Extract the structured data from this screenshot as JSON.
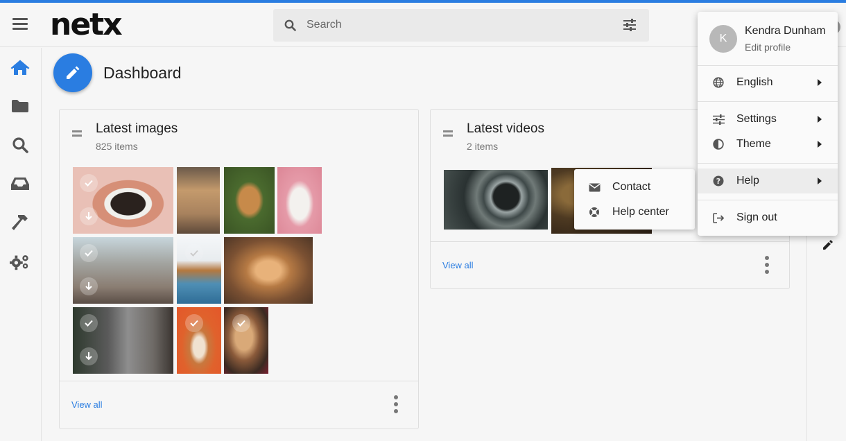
{
  "app": {
    "logo": "netx"
  },
  "search": {
    "placeholder": "Search"
  },
  "sidebar": {
    "items": [
      {
        "name": "home",
        "icon": "home-icon",
        "active": true
      },
      {
        "name": "folders",
        "icon": "folder-icon"
      },
      {
        "name": "search",
        "icon": "search-icon"
      },
      {
        "name": "inbox",
        "icon": "inbox-icon"
      },
      {
        "name": "tools",
        "icon": "hammer-icon"
      },
      {
        "name": "admin",
        "icon": "gears-icon"
      }
    ]
  },
  "page": {
    "title": "Dashboard"
  },
  "cards": {
    "images": {
      "title": "Latest images",
      "count": "825 items",
      "view_all": "View all"
    },
    "videos": {
      "title": "Latest videos",
      "count": "2 items",
      "view_all": "View all"
    }
  },
  "user_menu": {
    "avatar_initial": "K",
    "user_name": "Kendra Dunham",
    "edit_profile": "Edit profile",
    "items": [
      {
        "label": "English",
        "icon": "globe-icon",
        "has_submenu": true
      },
      {
        "label": "Settings",
        "icon": "sliders-icon",
        "has_submenu": true
      },
      {
        "label": "Theme",
        "icon": "contrast-icon",
        "has_submenu": true
      },
      {
        "label": "Help",
        "icon": "question-circle-icon",
        "has_submenu": true,
        "active": true
      },
      {
        "label": "Sign out",
        "icon": "sign-out-icon",
        "has_submenu": false
      }
    ]
  },
  "help_submenu": {
    "items": [
      {
        "label": "Contact",
        "icon": "envelope-icon"
      },
      {
        "label": "Help center",
        "icon": "life-ring-icon"
      }
    ]
  },
  "colors": {
    "accent": "#2a7de1",
    "background": "#f6f6f6"
  }
}
